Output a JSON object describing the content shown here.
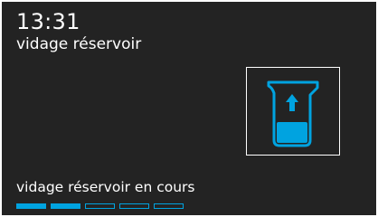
{
  "header": {
    "time": "13:31",
    "title": "vidage réservoir"
  },
  "status": {
    "message": "vidage réservoir en cours"
  },
  "progress": {
    "segments_total": 5,
    "segments_filled": 2
  },
  "icon": {
    "name": "pitcher-emptying-icon",
    "accent_color": "#00a3e0",
    "frame_color": "#ffffff"
  },
  "colors": {
    "background": "#232323",
    "accent": "#00a3e0",
    "text": "#ffffff"
  }
}
